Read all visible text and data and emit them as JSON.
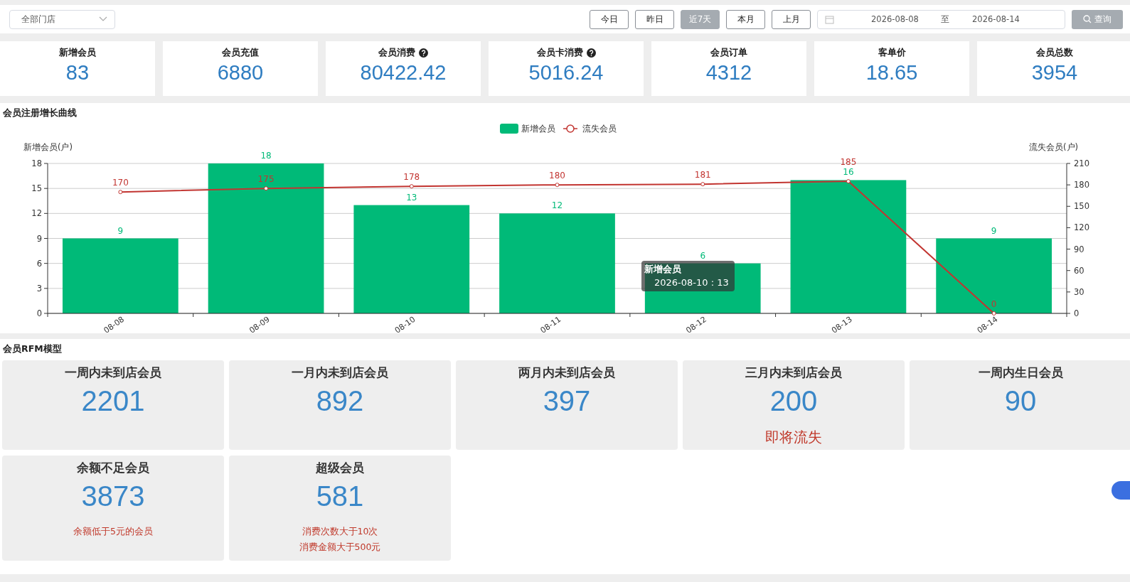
{
  "toolbar": {
    "store_select": {
      "value": "全部门店"
    },
    "range_buttons": [
      {
        "label": "今日",
        "selected": false
      },
      {
        "label": "昨日",
        "selected": false
      },
      {
        "label": "近7天",
        "selected": true
      },
      {
        "label": "本月",
        "selected": false
      },
      {
        "label": "上月",
        "selected": false
      }
    ],
    "date_range": {
      "start": "2026-08-08",
      "separator": "至",
      "end": "2026-08-14"
    },
    "query_button": "查询"
  },
  "kpis": [
    {
      "label": "新增会员",
      "value": "83",
      "help": false
    },
    {
      "label": "会员充值",
      "value": "6880",
      "help": false
    },
    {
      "label": "会员消费",
      "value": "80422.42",
      "help": true
    },
    {
      "label": "会员卡消费",
      "value": "5016.24",
      "help": true
    },
    {
      "label": "会员订单",
      "value": "4312",
      "help": false
    },
    {
      "label": "客单价",
      "value": "18.65",
      "help": false
    },
    {
      "label": "会员总数",
      "value": "3954",
      "help": false
    }
  ],
  "growth_chart": {
    "title": "会员注册增长曲线",
    "bars": {
      "chart_data": {
        "type": "bar",
        "ylabel": "新增会员(户)",
        "categories": [
          "08-08",
          "08-09",
          "08-10",
          "08-11",
          "08-12",
          "08-13",
          "08-14"
        ],
        "ylim": [
          0,
          18
        ],
        "yticks": [
          0,
          3,
          6,
          9,
          12,
          15,
          18
        ],
        "data_labels": true,
        "grid": true,
        "series": [
          {
            "name": "新增会员",
            "color": "#00ba78",
            "values": [
              9,
              18,
              13,
              12,
              6,
              16,
              9
            ]
          }
        ]
      }
    },
    "line": {
      "chart_data": {
        "type": "line",
        "ylabel": "流失会员(户)",
        "ylim": [
          0,
          210
        ],
        "yticks": [
          0,
          30,
          60,
          90,
          120,
          150,
          180,
          210
        ],
        "data_labels": true,
        "series": [
          {
            "name": "流失会员",
            "color": "#c23531",
            "values": [
              170,
              175,
              178,
              180,
              181,
              185,
              0
            ],
            "marker": true
          }
        ]
      }
    },
    "tooltip": {
      "title": "新增会员",
      "text": "2026-08-10 : 13"
    }
  },
  "rfm": {
    "title": "会员RFM模型",
    "cards": [
      {
        "label": "一周内未到店会员",
        "value": "2201"
      },
      {
        "label": "一月内未到店会员",
        "value": "892"
      },
      {
        "label": "两月内未到店会员",
        "value": "397"
      },
      {
        "label": "三月内未到店会员",
        "value": "200",
        "notes": [
          {
            "text": "即将流失",
            "kind": "large"
          }
        ]
      },
      {
        "label": "一周内生日会员",
        "value": "90"
      },
      {
        "label": "余额不足会员",
        "value": "3873",
        "notes": [
          {
            "text": "余额低于5元的会员",
            "kind": "small"
          }
        ]
      },
      {
        "label": "超级会员",
        "value": "581",
        "notes": [
          {
            "text": "消费次数大于10次",
            "kind": "small"
          },
          {
            "text": "消费金额大于500元",
            "kind": "small"
          }
        ]
      }
    ]
  }
}
